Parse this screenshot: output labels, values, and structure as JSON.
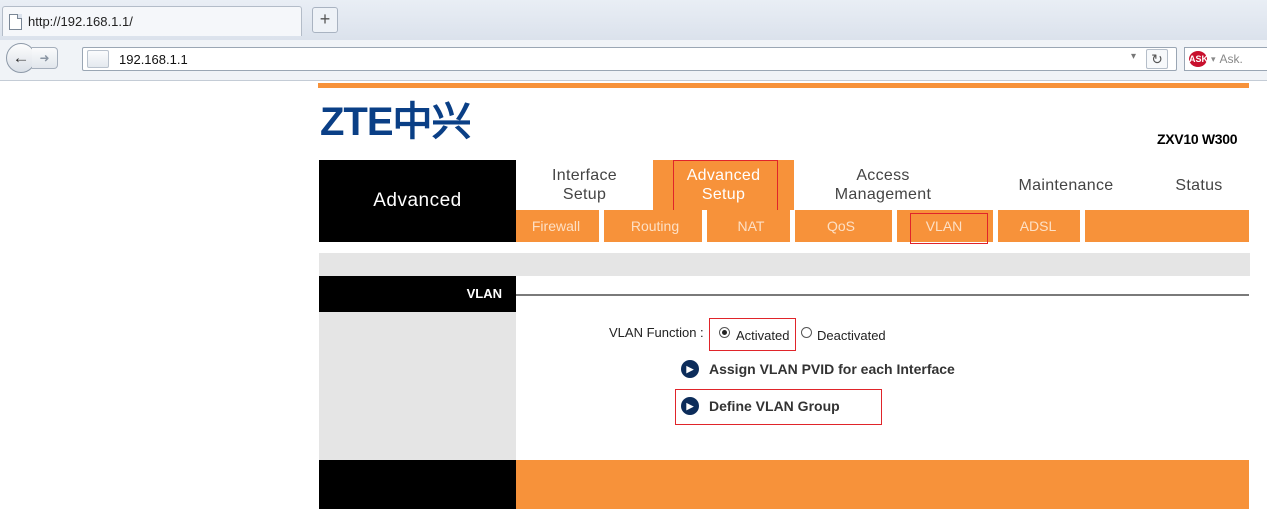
{
  "browser": {
    "tab_title": "http://192.168.1.1/",
    "new_tab_label": "+",
    "url": "192.168.1.1",
    "search_placeholder": "Ask."
  },
  "router": {
    "logo": "ZTE中兴",
    "model": "ZXV10 W300",
    "section": "Advanced",
    "main_menu": [
      {
        "label": "Interface Setup",
        "active": false
      },
      {
        "label": "Advanced Setup",
        "active": true
      },
      {
        "label": "Access Management",
        "active": false
      },
      {
        "label": "Maintenance",
        "active": false
      },
      {
        "label": "Status",
        "active": false
      }
    ],
    "sub_menu": [
      {
        "label": "Firewall"
      },
      {
        "label": "Routing"
      },
      {
        "label": "NAT"
      },
      {
        "label": "QoS"
      },
      {
        "label": "VLAN",
        "active": true
      },
      {
        "label": "ADSL"
      }
    ],
    "page_section": "VLAN",
    "vlan_function_label": "VLAN Function :",
    "vlan_function_options": [
      {
        "label": "Activated",
        "selected": true
      },
      {
        "label": "Deactivated",
        "selected": false
      }
    ],
    "links": [
      {
        "label": "Assign VLAN PVID for each Interface",
        "icon": "arrow-bullet-icon"
      },
      {
        "label": "Define VLAN Group",
        "icon": "arrow-bullet-icon"
      }
    ]
  },
  "colors": {
    "accent_orange": "#f7923a",
    "highlight_red": "#e0242a",
    "logo_blue": "#0a3f86"
  }
}
